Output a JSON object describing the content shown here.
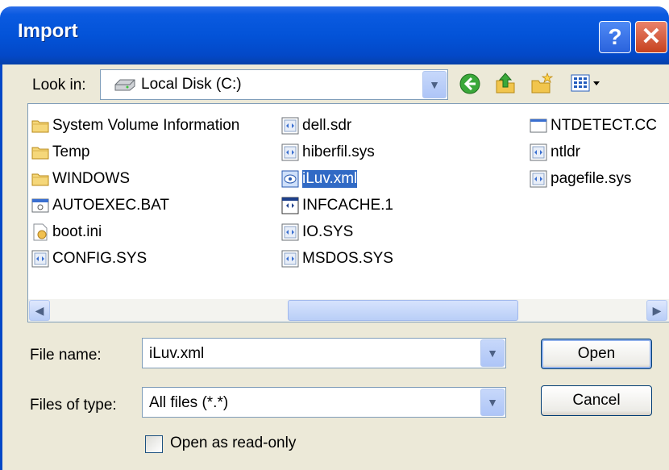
{
  "dialog": {
    "title": "Import"
  },
  "lookin": {
    "label": "Look in:",
    "value": "Local Disk (C:)"
  },
  "files": [
    {
      "name": "System Volume Information",
      "kind": "folder"
    },
    {
      "name": "Temp",
      "kind": "folder"
    },
    {
      "name": "WINDOWS",
      "kind": "folder"
    },
    {
      "name": "AUTOEXEC.BAT",
      "kind": "bat"
    },
    {
      "name": "boot.ini",
      "kind": "ini"
    },
    {
      "name": "CONFIG.SYS",
      "kind": "sys"
    },
    {
      "name": "dell.sdr",
      "kind": "sys"
    },
    {
      "name": "hiberfil.sys",
      "kind": "sys"
    },
    {
      "name": "iLuv.xml",
      "kind": "xml",
      "selected": true
    },
    {
      "name": "INFCACHE.1",
      "kind": "app"
    },
    {
      "name": "IO.SYS",
      "kind": "sys"
    },
    {
      "name": "MSDOS.SYS",
      "kind": "sys"
    },
    {
      "name": "NTDETECT.CC",
      "kind": "blank"
    },
    {
      "name": "ntldr",
      "kind": "sys"
    },
    {
      "name": "pagefile.sys",
      "kind": "sys"
    }
  ],
  "filename": {
    "label": "File name:",
    "value": "iLuv.xml"
  },
  "filetype": {
    "label": "Files of type:",
    "value": "All files (*.*)"
  },
  "buttons": {
    "open": "Open",
    "cancel": "Cancel"
  },
  "readonly": {
    "label": "Open as read-only",
    "checked": false
  }
}
